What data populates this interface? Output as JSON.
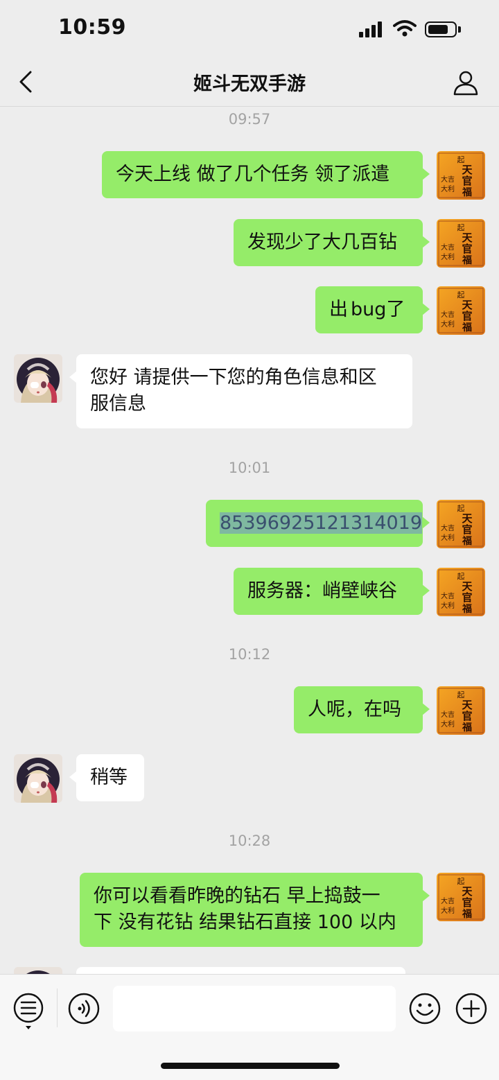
{
  "status_bar": {
    "time": "10:59",
    "icons": [
      "cellular-signal-icon",
      "wifi-icon",
      "battery-icon"
    ]
  },
  "nav": {
    "title": "姬斗无双手游",
    "back_icon": "chevron-left-icon",
    "profile_icon": "person-icon"
  },
  "colors": {
    "sent_bubble": "#95ec69",
    "received_bubble": "#ffffff",
    "background": "#ededed",
    "timestamp": "#a3a3a3"
  },
  "messages": {
    "t1": "09:57",
    "m1": "今天上线 做了几个任务 领了派遣",
    "m2": "发现少了大几百钻",
    "m3_prefix": "出",
    "m3_bug": "bug",
    "m3_suffix": "了",
    "m4_line1": "您好 请提供一下您的角色信息和区",
    "m4_line2": "服信息",
    "t2": "10:01",
    "m5": "85396925121314019",
    "m6": "服务器：峭壁峡谷",
    "t3": "10:12",
    "m7": "人呢，在吗",
    "m8": "稍等",
    "t4": "10:28",
    "m9_line1": "你可以看看昨晚的钻石 早上捣鼓一",
    "m9_line2": "下 没有花钻 结果钻石直接 100 以内"
  },
  "avatars": {
    "self_text": [
      "起",
      "天",
      "官",
      "賜",
      "福",
      "大",
      "吉",
      "大",
      "利"
    ],
    "agent_icon": "anime-girl-avatar-icon"
  },
  "input_bar": {
    "message_value": "",
    "icons": [
      "list-toggle-icon",
      "voice-icon",
      "emoji-icon",
      "plus-icon"
    ]
  }
}
